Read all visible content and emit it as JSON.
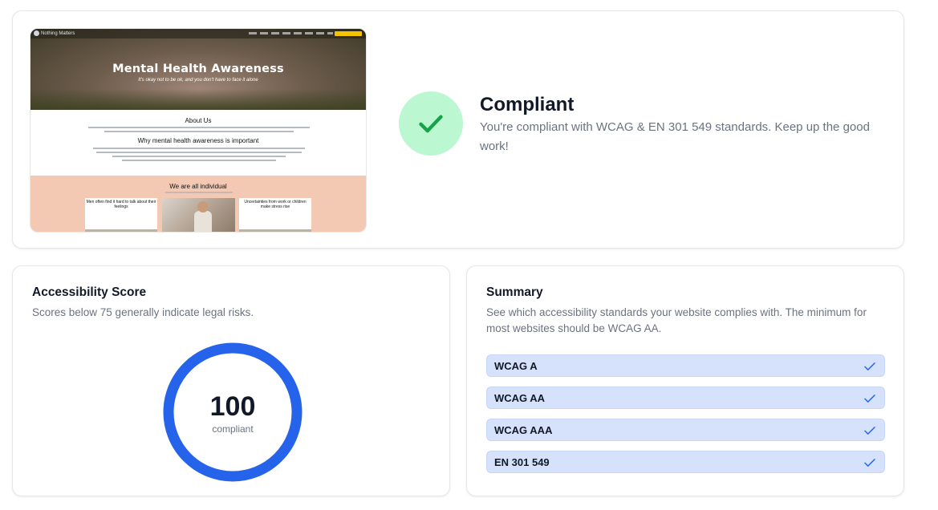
{
  "preview": {
    "site_name": "Nothing Matters",
    "hero_title": "Mental Health Awareness",
    "hero_subtitle": "It's okay not to be ok, and you don't have to face it alone",
    "about_heading": "About Us",
    "why_heading": "Why mental health awareness is important",
    "individual_heading": "We are all individual",
    "card_left_title": "Men often find it hard to talk about their feelings",
    "card_right_title": "Uncertainties from work or children make stress rise"
  },
  "status": {
    "title": "Compliant",
    "description": "You're compliant with WCAG & EN 301 549 standards. Keep up the good work!",
    "icon": "check-icon",
    "color": "#16a34a"
  },
  "score": {
    "title": "Accessibility Score",
    "description": "Scores below 75 generally indicate legal risks.",
    "value": "100",
    "label": "compliant",
    "percent": 100,
    "color": "#2563eb"
  },
  "summary": {
    "title": "Summary",
    "description": "See which accessibility standards your website complies with. The minimum for most websites should be WCAG AA.",
    "standards": [
      {
        "label": "WCAG A",
        "passed": true
      },
      {
        "label": "WCAG AA",
        "passed": true
      },
      {
        "label": "WCAG AAA",
        "passed": true
      },
      {
        "label": "EN 301 549",
        "passed": true
      }
    ]
  }
}
